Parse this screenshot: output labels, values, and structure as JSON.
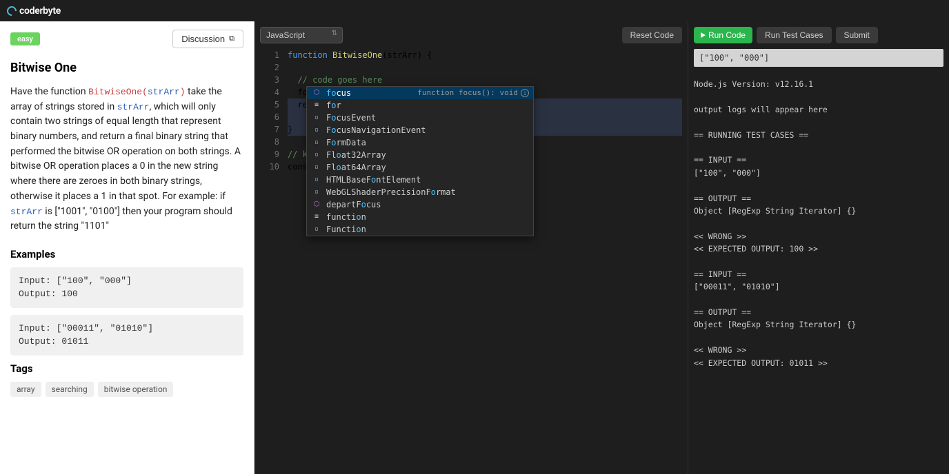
{
  "header": {
    "brand": "coderbyte"
  },
  "left": {
    "badge": "easy",
    "discussion": "Discussion",
    "title": "Bitwise One",
    "desc_prefix": "Have the function ",
    "fn_name": "BitwiseOne",
    "fn_sig_open": "(",
    "fn_arg": "strArr",
    "fn_sig_close": ")",
    "desc_mid1": " take the array of strings stored in ",
    "desc_mid2": ", which will only contain two strings of equal length that represent binary numbers, and return a final binary string that performed the bitwise OR operation on both strings. A bitwise OR operation places a 0 in the new string where there are zeroes in both binary strings, otherwise it places a 1 in that spot. For example: if ",
    "desc_mid3": " is [\"1001\", \"0100\"] then your program should return the string \"1101\"",
    "examples_heading": "Examples",
    "ex1_in": "Input: [\"100\", \"000\"]",
    "ex1_out": "Output: 100",
    "ex2_in": "Input: [\"00011\", \"01010\"]",
    "ex2_out": "Output: 01011",
    "tags_heading": "Tags",
    "tags": [
      "array",
      "searching",
      "bitwise operation"
    ]
  },
  "editor": {
    "language": "JavaScript",
    "reset": "Reset Code",
    "lines": [
      "1",
      "2",
      "3",
      "4",
      "5",
      "6",
      "7",
      "8",
      "9",
      "10"
    ],
    "ac_hint": "function focus(): void",
    "ac": [
      {
        "icon": "cube",
        "pre": "",
        "hl": "fo",
        "post": "cus",
        "sel": true
      },
      {
        "icon": "snip",
        "pre": "f",
        "hl": "o",
        "post": "r"
      },
      {
        "icon": "sq",
        "pre": "F",
        "hl": "o",
        "post": "cusEvent"
      },
      {
        "icon": "sq",
        "pre": "F",
        "hl": "o",
        "post": "cusNavigationEvent"
      },
      {
        "icon": "sq",
        "pre": "F",
        "hl": "o",
        "post": "rmData"
      },
      {
        "icon": "sq",
        "pre": "Fl",
        "hl": "o",
        "post": "at32Array"
      },
      {
        "icon": "sq",
        "pre": "Fl",
        "hl": "o",
        "post": "at64Array"
      },
      {
        "icon": "sq",
        "pre": "HTMLBaseF",
        "hl": "o",
        "post": "ntElement"
      },
      {
        "icon": "sq",
        "pre": "WebGLShaderPrecisionF",
        "hl": "o",
        "post": "rmat"
      },
      {
        "icon": "cube",
        "pre": "departF",
        "hl": "o",
        "post": "cus"
      },
      {
        "icon": "snip",
        "pre": "functi",
        "hl": "o",
        "post": "n"
      },
      {
        "icon": "sq",
        "pre": "Functi",
        "hl": "o",
        "post": "n"
      }
    ]
  },
  "right": {
    "run": "Run Code",
    "test": "Run Test Cases",
    "submit": "Submit",
    "input": "[\"100\", \"000\"]",
    "console": "Node.js Version: v12.16.1\n\noutput logs will appear here\n\n== RUNNING TEST CASES ==\n\n== INPUT ==\n[\"100\", \"000\"]\n\n== OUTPUT ==\nObject [RegExp String Iterator] {}\n\n<< WRONG >>\n<< EXPECTED OUTPUT: 100 >>\n\n== INPUT ==\n[\"00011\", \"01010\"]\n\n== OUTPUT ==\nObject [RegExp String Iterator] {}\n\n<< WRONG >>\n<< EXPECTED OUTPUT: 01011 >>"
  }
}
